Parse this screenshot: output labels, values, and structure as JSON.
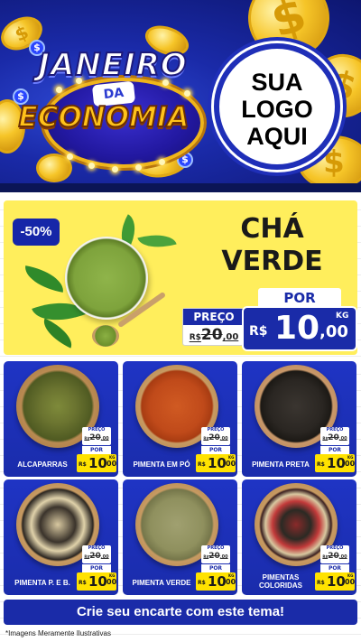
{
  "header": {
    "title_line1": "JANEIRO",
    "title_line2": "DA",
    "title_line3": "ECONOMIA",
    "logo_placeholder": [
      "SUA",
      "LOGO",
      "AQUI"
    ],
    "coin_symbol": "$",
    "colors": {
      "background": "#1a2aa8",
      "gold": "#f6c528"
    }
  },
  "featured": {
    "discount": "-50%",
    "name_lines": [
      "CHÁ",
      "VERDE"
    ],
    "preco_label": "PREÇO",
    "old_price": {
      "currency": "R$",
      "int": "20",
      "dec": ",00"
    },
    "por_label": "POR",
    "price": {
      "currency": "R$",
      "int": "10",
      "dec": ",00",
      "unit": "KG"
    }
  },
  "products": [
    {
      "name": "ALCAPARRAS",
      "preco_label": "PREÇO",
      "old_price": {
        "currency": "R$",
        "int": "20",
        "dec": ",00"
      },
      "por_label": "POR",
      "price": {
        "currency": "R$",
        "int": "10",
        "dec": ",00",
        "unit": "KG"
      }
    },
    {
      "name": "PIMENTA EM PÓ",
      "preco_label": "PREÇO",
      "old_price": {
        "currency": "R$",
        "int": "20",
        "dec": ",00"
      },
      "por_label": "POR",
      "price": {
        "currency": "R$",
        "int": "10",
        "dec": ",00",
        "unit": "KG"
      }
    },
    {
      "name": "PIMENTA PRETA",
      "preco_label": "PREÇO",
      "old_price": {
        "currency": "R$",
        "int": "20",
        "dec": ",00"
      },
      "por_label": "POR",
      "price": {
        "currency": "R$",
        "int": "10",
        "dec": ",00",
        "unit": "KG"
      }
    },
    {
      "name": "PIMENTA P. E B.",
      "preco_label": "PREÇO",
      "old_price": {
        "currency": "R$",
        "int": "20",
        "dec": ",00"
      },
      "por_label": "POR",
      "price": {
        "currency": "R$",
        "int": "10",
        "dec": ",00",
        "unit": "KG"
      }
    },
    {
      "name": "PIMENTA VERDE",
      "preco_label": "PREÇO",
      "old_price": {
        "currency": "R$",
        "int": "20",
        "dec": ",00"
      },
      "por_label": "POR",
      "price": {
        "currency": "R$",
        "int": "10",
        "dec": ",00",
        "unit": "KG"
      }
    },
    {
      "name_lines": [
        "PIMENTAS",
        "COLORIDAS"
      ],
      "preco_label": "PREÇO",
      "old_price": {
        "currency": "R$",
        "int": "20",
        "dec": ",00"
      },
      "por_label": "POR",
      "price": {
        "currency": "R$",
        "int": "10",
        "dec": ",00",
        "unit": "KG"
      }
    }
  ],
  "cta": "Crie seu encarte com este tema!",
  "disclaimer": "*Imagens Meramente Ilustrativas",
  "colors": {
    "primary_blue": "#1a2ba8",
    "price_yellow": "#ffe200",
    "panel_yellow": "#ffee5c"
  }
}
